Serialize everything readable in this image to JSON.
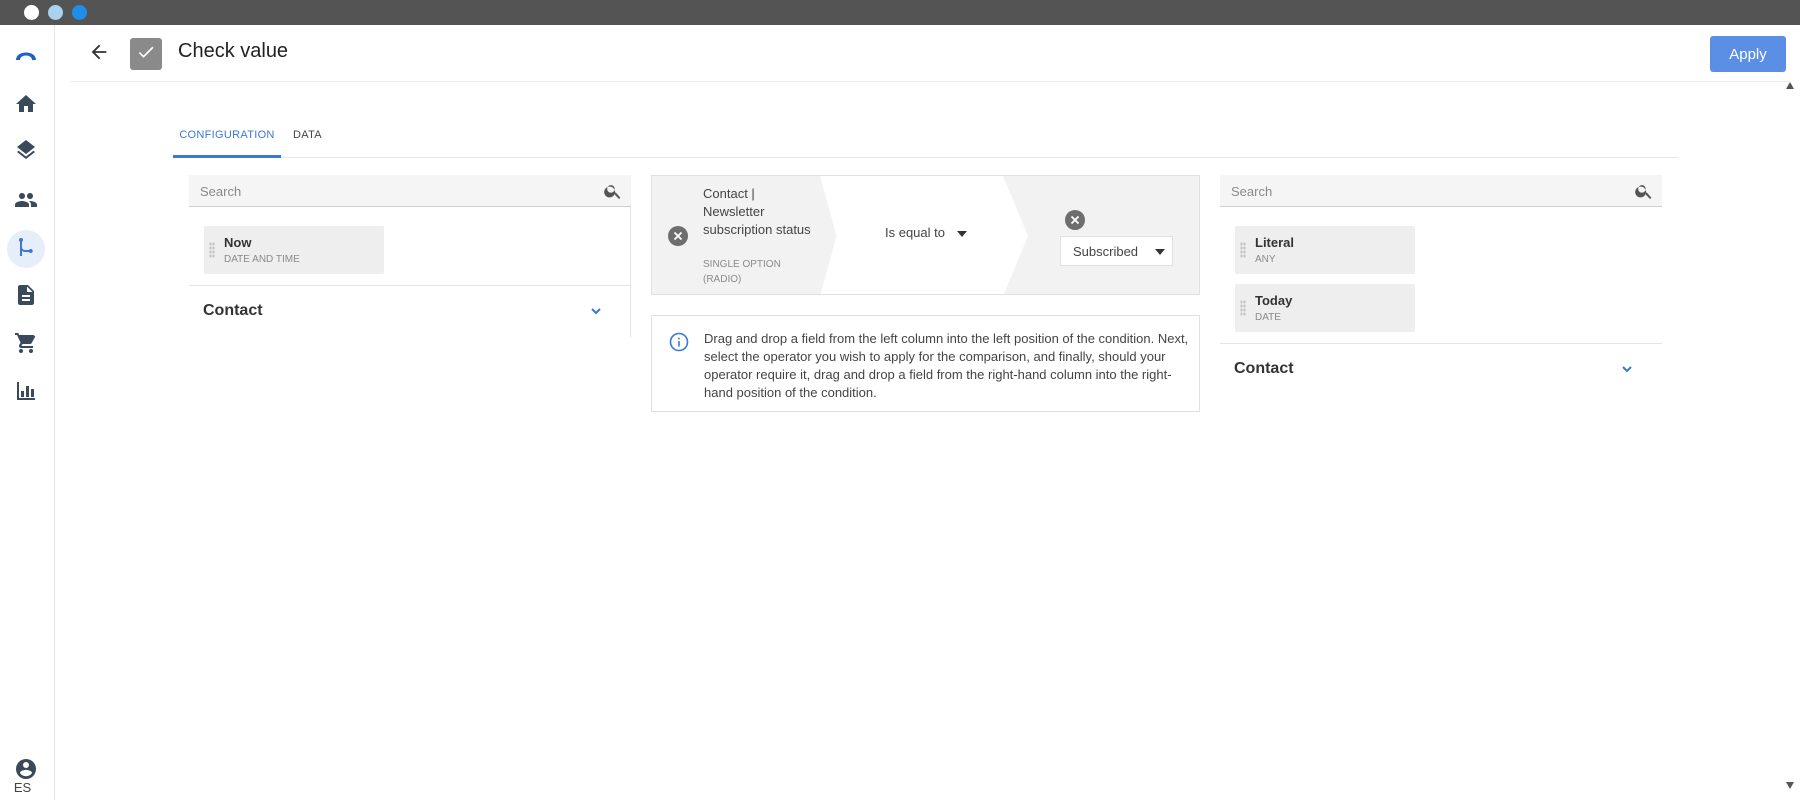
{
  "window": {
    "controls": [
      "close",
      "minimize",
      "maximize"
    ]
  },
  "sidebar": {
    "items": [
      {
        "name": "logo",
        "icon": "arch-logo-icon",
        "active": false
      },
      {
        "name": "home",
        "icon": "home-icon",
        "active": false
      },
      {
        "name": "layers",
        "icon": "layers-icon",
        "active": false
      },
      {
        "name": "contacts",
        "icon": "people-icon",
        "active": false
      },
      {
        "name": "workflows",
        "icon": "branch-icon",
        "active": true
      },
      {
        "name": "documents",
        "icon": "document-icon",
        "active": false
      },
      {
        "name": "commerce",
        "icon": "cart-icon",
        "active": false
      },
      {
        "name": "reports",
        "icon": "bar-chart-icon",
        "active": false
      }
    ],
    "account_icon": "account-circle-icon",
    "language": "ES"
  },
  "header": {
    "title": "Check value",
    "back_icon": "arrow-left-icon",
    "node_icon": "check-icon",
    "apply_label": "Apply"
  },
  "tabs": [
    {
      "label": "CONFIGURATION",
      "active": true
    },
    {
      "label": "DATA",
      "active": false
    }
  ],
  "left_panel": {
    "search_placeholder": "Search",
    "fields": [
      {
        "name": "Now",
        "type": "DATE AND TIME"
      }
    ],
    "group_label": "Contact"
  },
  "condition": {
    "left_field": "Contact | Newsletter subscription status",
    "left_type": "SINGLE OPTION (RADIO)",
    "operator": "Is equal to",
    "value": "Subscribed"
  },
  "info": {
    "text": "Drag and drop a field from the left column into the left position of the condition. Next, select the operator you wish to apply for the comparison, and finally, should your operator require it, drag and drop a field from the right-hand column into the right-hand position of the condition."
  },
  "right_panel": {
    "search_placeholder": "Search",
    "fields": [
      {
        "name": "Literal",
        "type": "ANY"
      },
      {
        "name": "Today",
        "type": "DATE"
      }
    ],
    "group_label": "Contact"
  },
  "colors": {
    "accent": "#3a78d6",
    "apply_button": "#5b8fe6",
    "titlebar": "#545454"
  }
}
